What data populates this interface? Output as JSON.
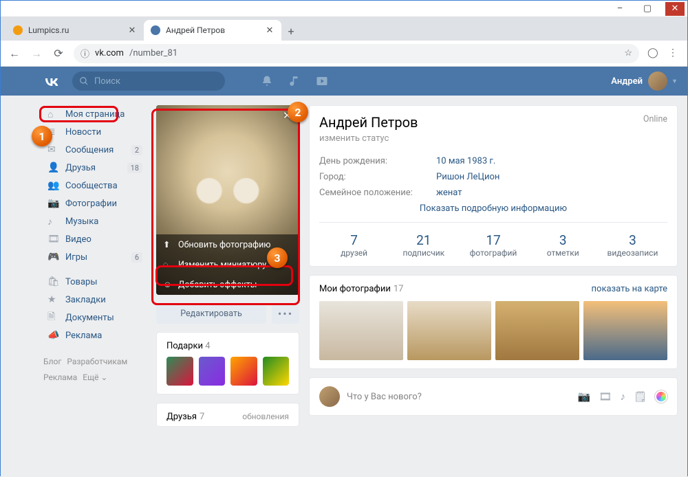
{
  "window": {
    "minimize": "–",
    "maximize": "▢",
    "close": "✕"
  },
  "browser": {
    "tabs": [
      {
        "title": "Lumpics.ru",
        "favicon": "#f39c12"
      },
      {
        "title": "Андрей Петров",
        "favicon": "#4a76a8"
      }
    ],
    "url_host": "vk.com",
    "url_path": "/number_81"
  },
  "vk": {
    "search_placeholder": "Поиск",
    "user_name": "Андрей"
  },
  "sidebar": {
    "items": [
      {
        "label": "Моя страница",
        "badge": ""
      },
      {
        "label": "Новости",
        "badge": ""
      },
      {
        "label": "Сообщения",
        "badge": "2"
      },
      {
        "label": "Друзья",
        "badge": "18"
      },
      {
        "label": "Сообщества",
        "badge": ""
      },
      {
        "label": "Фотографии",
        "badge": ""
      },
      {
        "label": "Музыка",
        "badge": ""
      },
      {
        "label": "Видео",
        "badge": ""
      },
      {
        "label": "Игры",
        "badge": "6"
      }
    ],
    "items2": [
      {
        "label": "Товары"
      },
      {
        "label": "Закладки"
      },
      {
        "label": "Документы"
      },
      {
        "label": "Реклама"
      }
    ],
    "footer": {
      "blog": "Блог",
      "dev": "Разработчикам",
      "ads": "Реклама",
      "more": "Ещё ⌄"
    }
  },
  "avatar": {
    "actions": {
      "update": "Обновить фотографию",
      "thumb": "Изменить миниатюру",
      "effects": "Добавить эффекты"
    },
    "edit": "Редактировать"
  },
  "gifts": {
    "title": "Подарки",
    "count": "4"
  },
  "friends": {
    "title": "Друзья",
    "count": "7",
    "updates": "обновления"
  },
  "profile": {
    "name": "Андрей Петров",
    "status": "изменить статус",
    "online": "Online",
    "rows": [
      {
        "label": "День рождения:",
        "value": "10 мая 1983 г."
      },
      {
        "label": "Город:",
        "value": "Ришон ЛеЦион"
      },
      {
        "label": "Семейное положение:",
        "value": "женат"
      }
    ],
    "show_more": "Показать подробную информацию",
    "counters": [
      {
        "num": "7",
        "lbl": "друзей"
      },
      {
        "num": "21",
        "lbl": "подписчик"
      },
      {
        "num": "17",
        "lbl": "фотографий"
      },
      {
        "num": "3",
        "lbl": "отметки"
      },
      {
        "num": "3",
        "lbl": "видеозаписи"
      }
    ]
  },
  "photos": {
    "title": "Мои фотографии",
    "count": "17",
    "map": "показать на карте"
  },
  "post": {
    "placeholder": "Что у Вас нового?"
  }
}
